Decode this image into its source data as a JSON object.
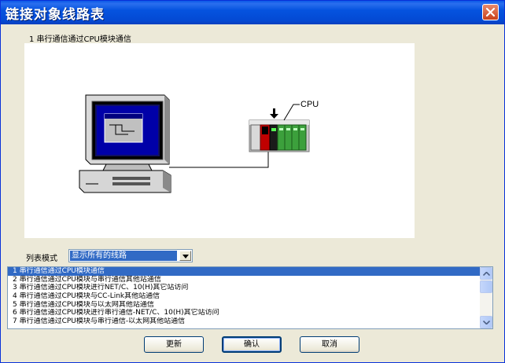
{
  "window": {
    "title": "链接对象线路表",
    "close_icon": "close-icon",
    "title_bar_color": "#0553df"
  },
  "caption": "1 串行通信通过CPU模块通信",
  "diagram": {
    "cpu_label": "CPU",
    "computer_icon": "personal-computer-icon",
    "plc_icon": "plc-rack-icon",
    "arrow_icon": "down-arrow-icon"
  },
  "list_mode": {
    "label": "列表模式",
    "selected": "显示所有的线路",
    "arrow_icon": "chevron-down-icon"
  },
  "routes": [
    "1 串行通信通过CPU模块通信",
    "2 串行通信通过CPU模块与串行通信其他站通信",
    "3 串行通信通过CPU模块进行NET/C、10(H)其它站访问",
    "4 串行通信通过CPU模块与CC-Link其他站通信",
    "5 串行通信通过CPU模块与以太网其他站通信",
    "6 串行通信通过CPU模块进行串行通信-NET/C、10(H)其它站访问",
    "7 串行通信通过CPU模块与串行通信-以太网其他站通信"
  ],
  "buttons": {
    "refresh": "更新",
    "ok": "确认",
    "cancel": "取消"
  },
  "colors": {
    "selection": "#316ac5",
    "dialog_bg": "#ece9d8"
  }
}
